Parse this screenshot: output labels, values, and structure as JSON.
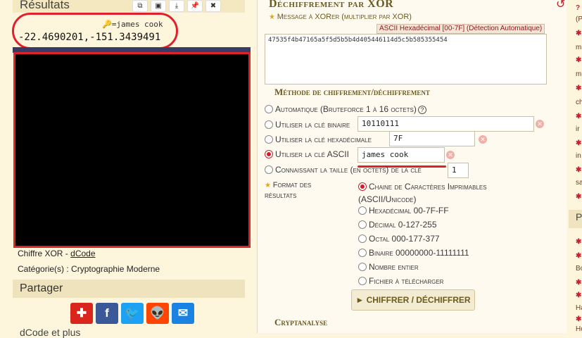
{
  "results": {
    "title": "Résultats",
    "toolbar": [
      "⧉",
      "▣",
      "⤓",
      "📌",
      "✖"
    ],
    "key_line": "=james cook",
    "value": "-22.4690201,-151.3439491"
  },
  "left": {
    "cipher_name_prefix": "Chiffre XOR - ",
    "cipher_name_link": "dCode",
    "category": "Catégorie(s) : Cryptographie Moderne",
    "share_title": "Partager",
    "share_buttons": [
      {
        "name": "share-addthis-button",
        "glyph": "✚",
        "color": "#d9251c"
      },
      {
        "name": "share-facebook-button",
        "glyph": "f",
        "color": "#3b5998"
      },
      {
        "name": "share-twitter-button",
        "glyph": "🐦",
        "color": "#1da1f2"
      },
      {
        "name": "share-reddit-button",
        "glyph": "👽",
        "color": "#ff4500"
      },
      {
        "name": "share-email-button",
        "glyph": "✉",
        "color": "#1a82e2"
      }
    ],
    "bottom_text": "dCode et plus"
  },
  "main": {
    "title": "Déchiffrement par XOR",
    "message_label": "Message à XORer (multiplier par XOR)",
    "message_badge": "ASCII Hexadécimal [00-7F] (Détection Automatique)",
    "message_value": "47535f4b47165a5f5d5b5b4d405446114d5c5b585355454",
    "method_heading": "Méthode de chiffrement/déchiffrement",
    "options": {
      "auto": "Automatique (Bruteforce 1 à 16 octets)",
      "binary": "Utiliser la clé binaire",
      "hex": "Utiliser la clé hexadécimale",
      "ascii": "Utiliser la clé ASCII",
      "size": "Connaissant la taille (en octets) de la clé"
    },
    "fields": {
      "binary": "10110111",
      "hex": "7F",
      "ascii": "james cook",
      "size": "1"
    },
    "format_label": "Format des résultats",
    "formats": {
      "printable": "Chaine de Caractères Imprimables",
      "printable2": "(ASCII/Unicode)",
      "hex": "Hexadécimal 00-7F-FF",
      "decimal": "Décimal 0-127-255",
      "octal": "Octal 000-177-377",
      "binary": "Binaire 00000000-11111111",
      "integer": "Nombre entier",
      "file": "Fichier à télécharger"
    },
    "submit": "► CHIFFRER / DÉCHIFFRER",
    "cryptanalysis_heading": "Cryptanalyse"
  },
  "right_strip": [
    "?",
    "(P",
    "",
    "m",
    "",
    "m",
    "",
    "ch",
    "",
    "ir",
    "",
    "in",
    "",
    "sa",
    "",
    "ch",
    "P",
    "",
    "",
    "Bo",
    "",
    "",
    "Ha",
    "",
    "Ho"
  ]
}
